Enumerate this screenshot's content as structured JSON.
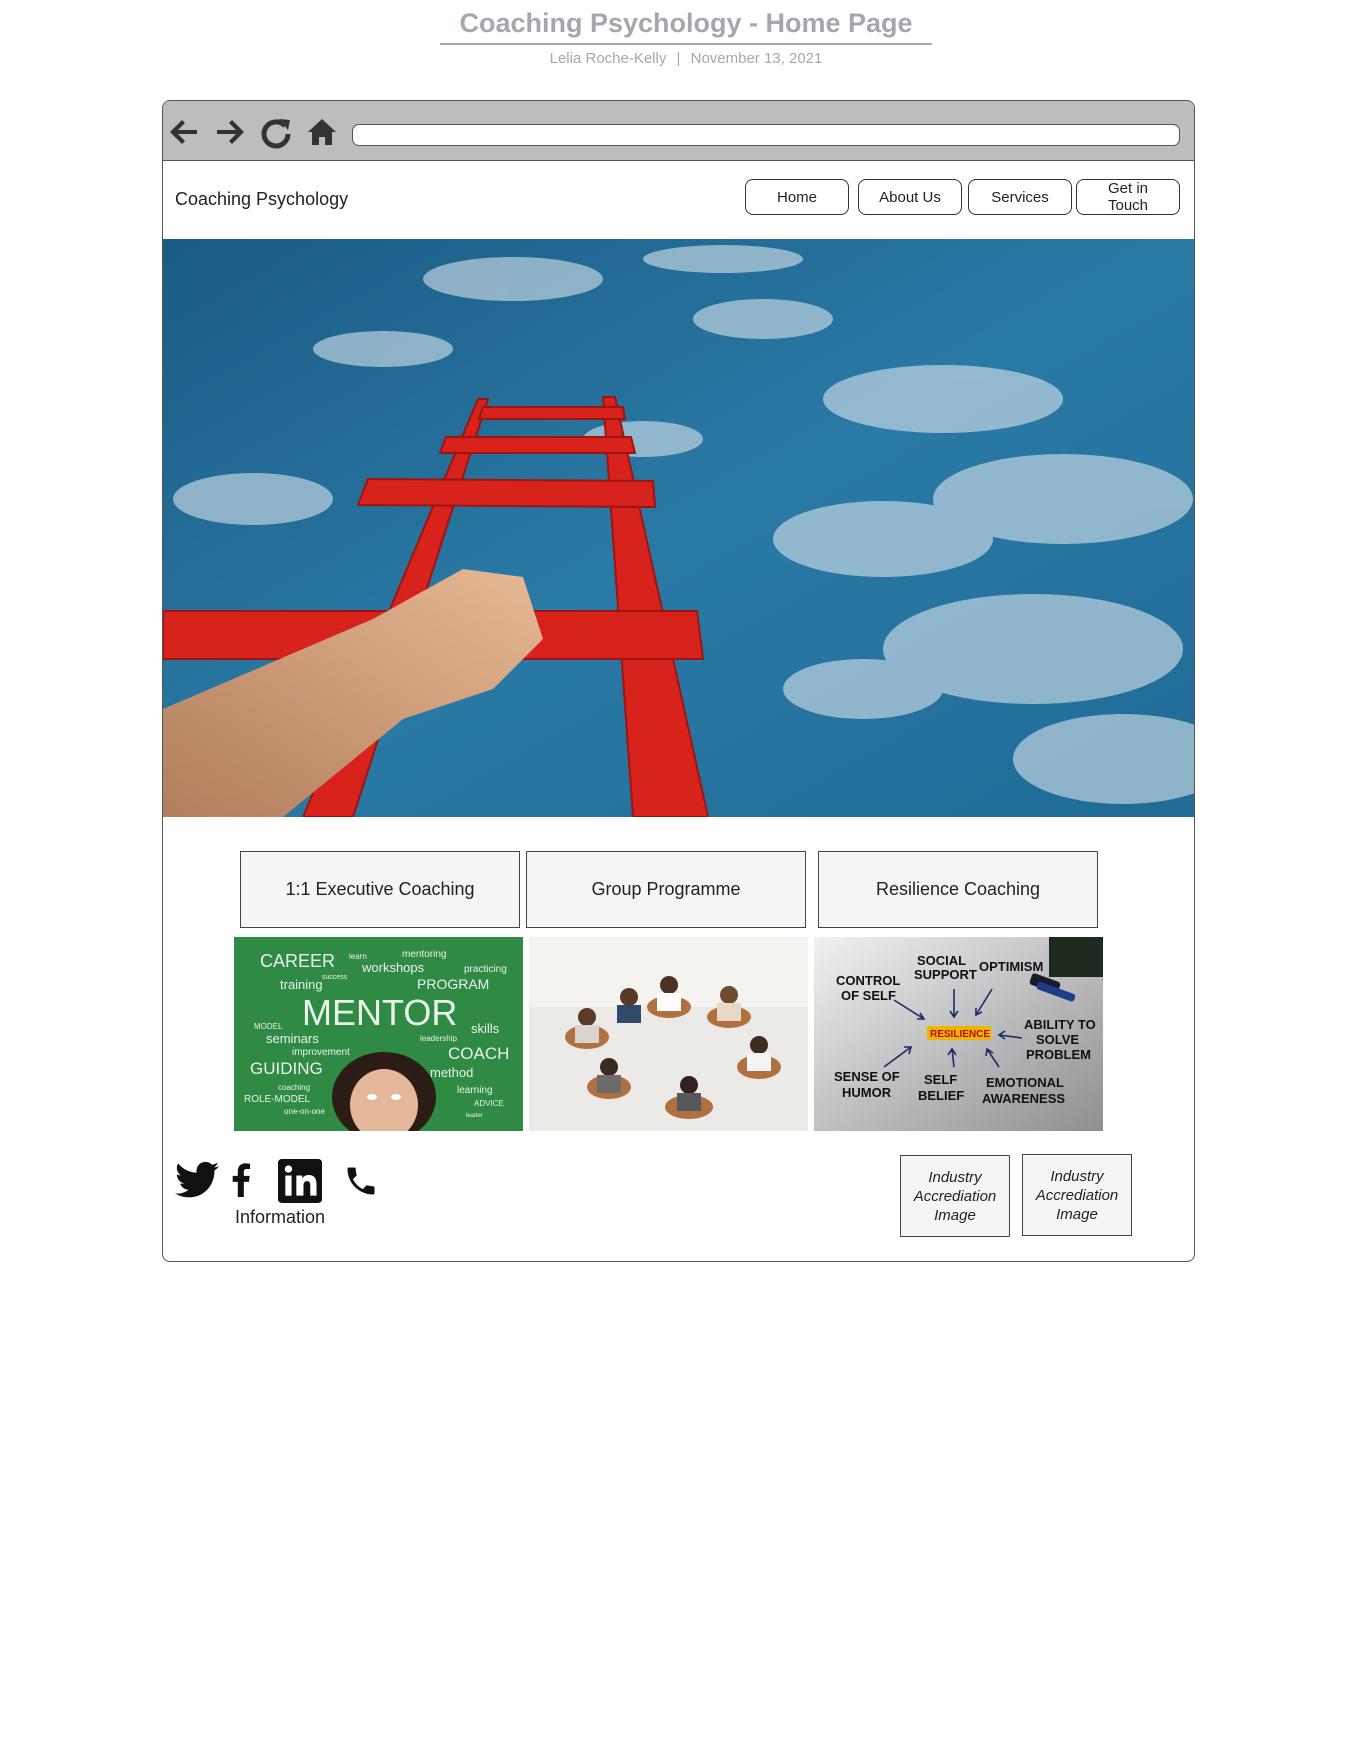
{
  "document": {
    "title": "Coaching Psychology - Home Page",
    "author": "Lelia Roche-Kelly",
    "separator": "|",
    "date": "November 13, 2021"
  },
  "browser": {
    "icons": [
      "back-arrow-icon",
      "forward-arrow-icon",
      "refresh-icon",
      "home-icon"
    ],
    "url_value": ""
  },
  "site": {
    "name": "Coaching Psychology",
    "nav": [
      {
        "label": "Home"
      },
      {
        "label": "About Us"
      },
      {
        "label": "Services"
      },
      {
        "label": "Get in Touch"
      }
    ]
  },
  "hero": {
    "image": "red-ladder-to-sky-photo"
  },
  "services": [
    {
      "label": "1:1 Executive Coaching",
      "image": "mentor-chalkboard-photo"
    },
    {
      "label": "Group Programme",
      "image": "group-circle-photo"
    },
    {
      "label": "Resilience Coaching",
      "image": "resilience-diagram-photo"
    }
  ],
  "mentor_words": {
    "w1": "CAREER",
    "w2": "learn",
    "w3": "mentoring",
    "w4": "workshops",
    "w5": "success",
    "w6": "practicing",
    "w7": "training",
    "w8": "PROGRAM",
    "w9": "MENTOR",
    "w10": "MODEL",
    "w11": "skills",
    "w12": "seminars",
    "w13": "leadership",
    "w14": "improvement",
    "w15": "COACH",
    "w16": "GUIDING",
    "w17": "method",
    "w18": "coaching",
    "w19": "learning",
    "w20": "ROLE-MODEL",
    "w21": "ADVICE",
    "w22": "one-on-one",
    "w23": "leader"
  },
  "resilience_words": {
    "social": "SOCIAL",
    "support": "SUPPORT",
    "optimism": "OPTIMISM",
    "control": "CONTROL",
    "of_self": "OF SELF",
    "center": "RESILIENCE",
    "ability": "ABILITY TO",
    "solve": "SOLVE",
    "problem": "PROBLEM",
    "sense": "SENSE OF",
    "humor": "HUMOR",
    "self": "SELF",
    "belief": "BELIEF",
    "emotional": "EMOTIONAL",
    "awareness": "AWARENESS"
  },
  "footer": {
    "social_icons": [
      "twitter-icon",
      "facebook-icon",
      "linkedin-icon",
      "phone-icon"
    ],
    "info_label": "Information",
    "accreditations": [
      {
        "label": "Industry Accrediation Image"
      },
      {
        "label": "Industry Accrediation Image"
      }
    ]
  },
  "colors": {
    "toolbar": "#bdbdbd",
    "sky": "#1f6b96",
    "ladder": "#d8231d",
    "chalkboard": "#2f8a44"
  }
}
